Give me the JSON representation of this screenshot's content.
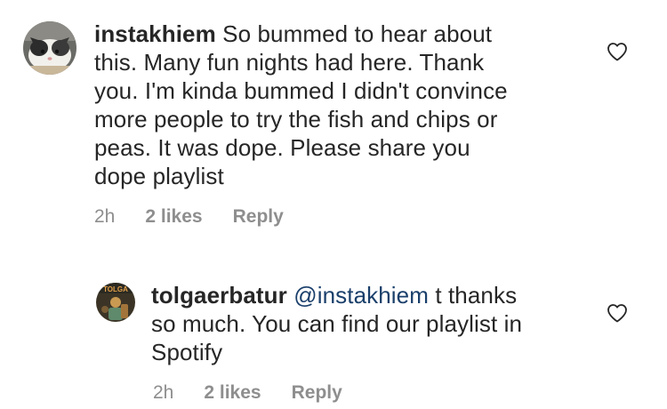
{
  "comments": [
    {
      "username": "instakhiem",
      "text": "So bummed to hear about this. Many fun nights had here. Thank you. I'm kinda bummed I didn't convince more people to try the fish and chips or peas. It was dope. Please share you dope playlist",
      "lines": [
        {
          "rest": "So bummed to hear about"
        },
        {
          "rest": "this. Many fun nights had here. Thank"
        },
        {
          "rest": "you. I'm kinda bummed I didn't convince"
        },
        {
          "rest": "more people to try the fish and chips or"
        },
        {
          "rest": "peas. It was dope. Please share you"
        },
        {
          "rest": "dope playlist"
        }
      ],
      "time": "2h",
      "likes": "2 likes",
      "reply_label": "Reply",
      "avatar_icon": "cat-photo-avatar",
      "like_icon": "heart-outline-icon"
    },
    {
      "username": "tolgaerbatur",
      "mention": "@instakhiem",
      "lines": [
        {
          "rest": " t thanks"
        },
        {
          "rest": "so much. You can find our playlist in"
        },
        {
          "rest": "Spotify"
        }
      ],
      "avatar_label": "TOLGA",
      "time": "2h",
      "likes": "2 likes",
      "reply_label": "Reply",
      "avatar_icon": "illustrated-avatar",
      "like_icon": "heart-outline-icon"
    }
  ],
  "colors": {
    "text": "#262626",
    "meta": "#8e8e8e",
    "mention": "#1a3f6b"
  }
}
